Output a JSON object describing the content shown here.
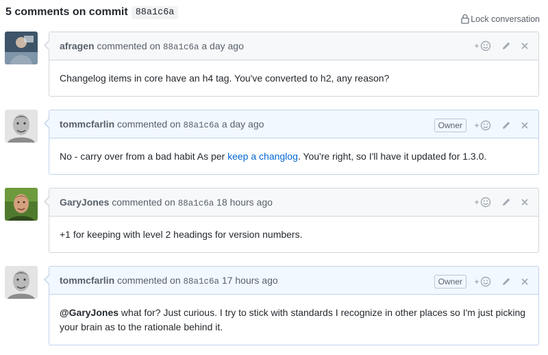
{
  "header": {
    "title": "5 comments on commit",
    "sha": "88a1c6a",
    "lock_label": "Lock conversation"
  },
  "colors": {
    "link": "#0366d6",
    "header_bg": "#f6f8fa",
    "owner_header_bg": "#f1f8ff",
    "border": "#d1d5da"
  },
  "comments": [
    {
      "author": "afragen",
      "verb": "commented on",
      "sha": "88a1c6a",
      "time": "a day ago",
      "owner": false,
      "body": "Changelog items in core have an h4 tag. You've converted to h2, any reason?"
    },
    {
      "author": "tommcfarlin",
      "verb": "commented on",
      "sha": "88a1c6a",
      "time": "a day ago",
      "owner": true,
      "owner_label": "Owner",
      "body_pre": "No - carry over from a bad habit As per ",
      "body_link": "keep a changlog",
      "body_post": ". You're right, so I'll have it updated for 1.3.0."
    },
    {
      "author": "GaryJones",
      "verb": "commented on",
      "sha": "88a1c6a",
      "time": "18 hours ago",
      "owner": false,
      "body": "+1 for keeping with level 2 headings for version numbers."
    },
    {
      "author": "tommcfarlin",
      "verb": "commented on",
      "sha": "88a1c6a",
      "time": "17 hours ago",
      "owner": true,
      "owner_label": "Owner",
      "body_mention": "@GaryJones",
      "body_rest": " what for? Just curious. I try to stick with standards I recognize in other places so I'm just picking your brain as to the rationale behind it."
    }
  ],
  "icons": {
    "lock": "lock-icon",
    "reaction": "add-reaction-icon",
    "edit": "pencil-icon",
    "delete": "close-icon"
  }
}
